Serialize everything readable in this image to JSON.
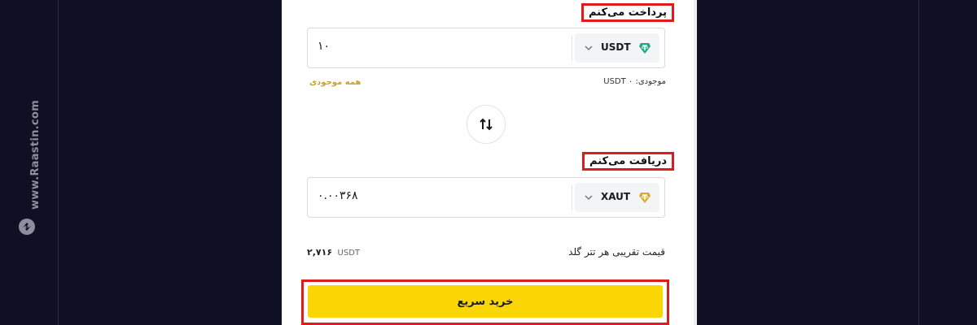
{
  "watermark": {
    "site": "www.Raastin.com",
    "brand_icon": "raastin-logo-icon"
  },
  "pay": {
    "label": "پرداخت می‌کنم",
    "amount": "۱۰",
    "coin": "USDT",
    "coin_icon": "tether-icon",
    "coin_color": "#26a17b",
    "balance": "موجودی: USDT ۰",
    "all_balance": "همه موجودی"
  },
  "swap": {
    "icon": "swap-arrows-icon"
  },
  "receive": {
    "label": "دریافت می‌کنم",
    "amount": "۰.۰۰۳۶۸",
    "coin": "XAUT",
    "coin_icon": "tether-gold-icon",
    "coin_color": "#d4a940"
  },
  "price": {
    "label": "قیمت تقریبی هر تتر گلد",
    "value": "۲,۷۱۶",
    "unit": "USDT"
  },
  "buy_button": {
    "label": "خرید سریع",
    "color": "#fcd505"
  },
  "highlight_color": "#e01b1b"
}
